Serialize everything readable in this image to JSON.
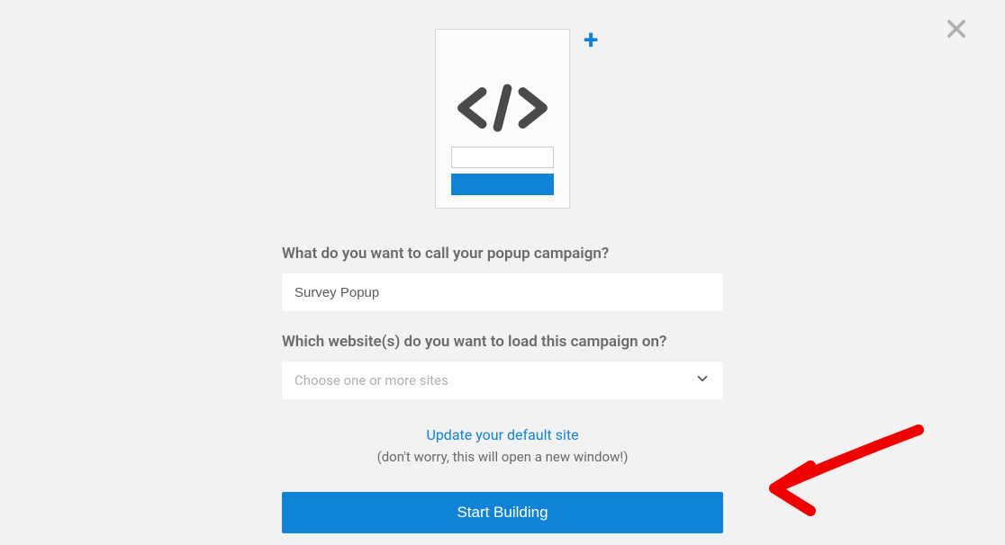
{
  "form": {
    "campaign_name_label": "What do you want to call your popup campaign?",
    "campaign_name_value": "Survey Popup",
    "website_label": "Which website(s) do you want to load this campaign on?",
    "website_placeholder": "Choose one or more sites",
    "update_link": "Update your default site",
    "note": "(don't worry, this will open a new window!)",
    "submit_label": "Start Building"
  },
  "icons": {
    "plus": "+"
  }
}
